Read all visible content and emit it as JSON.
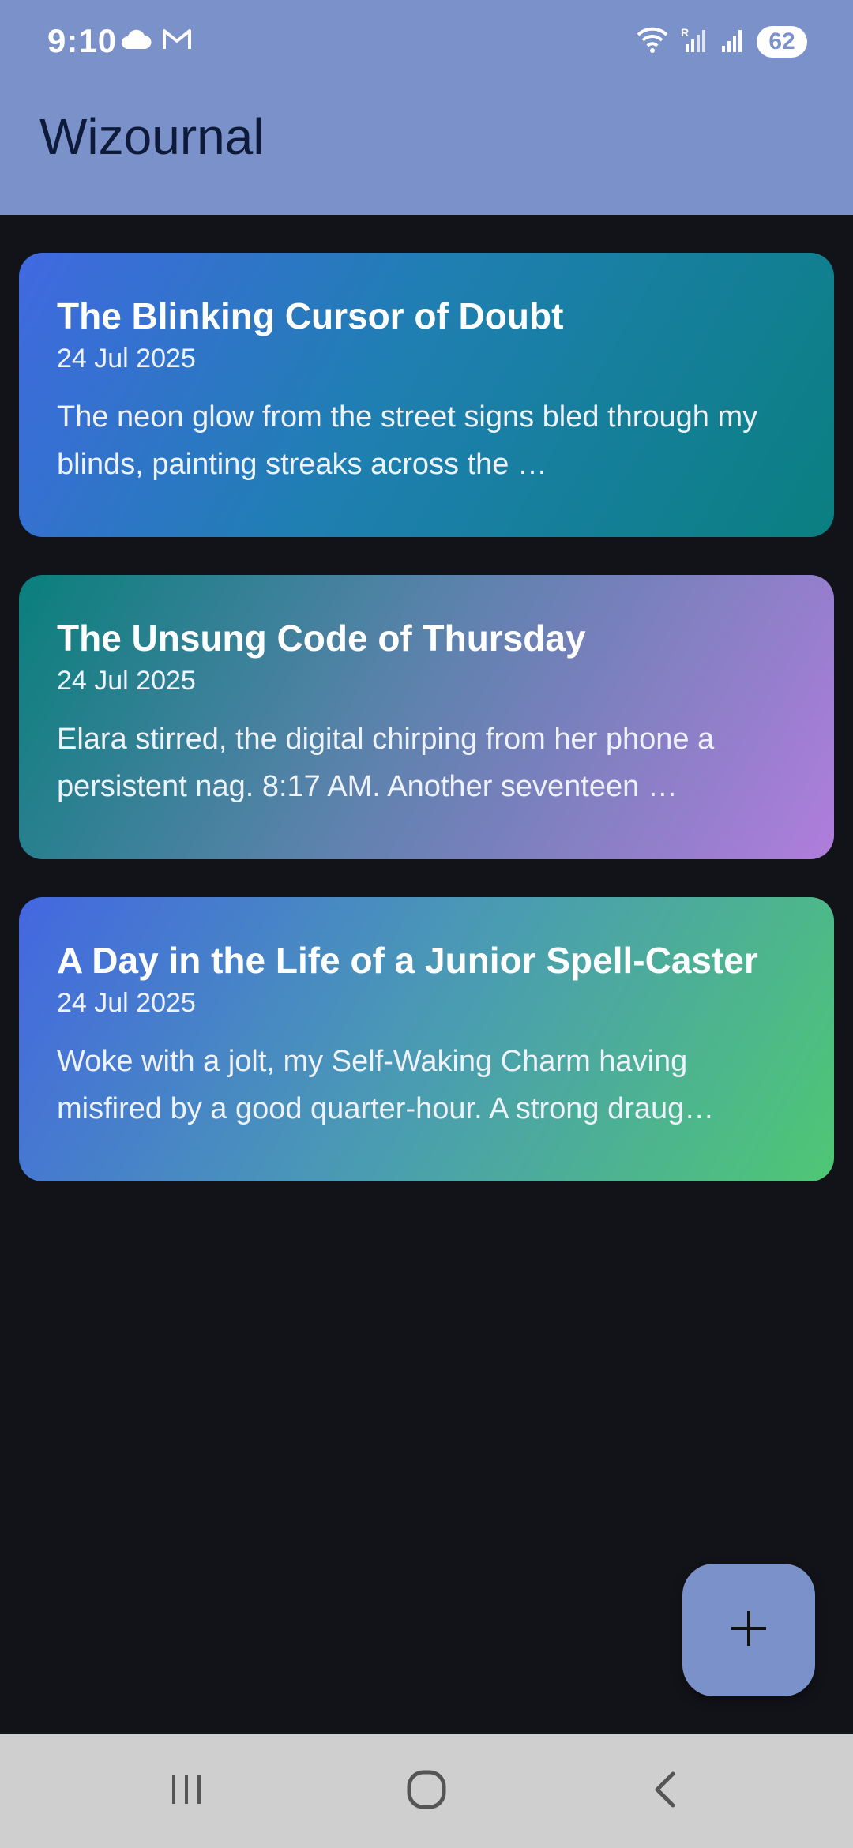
{
  "status_bar": {
    "time": "9:10",
    "battery": "62",
    "left_icons": [
      "cloud-icon",
      "gmail-icon"
    ],
    "right_icons": [
      "wifi-icon",
      "signal-r-icon",
      "signal-icon",
      "battery-icon"
    ]
  },
  "app_bar": {
    "title": "Wizournal",
    "color": "#7b91c9"
  },
  "entries": [
    {
      "title": "The Blinking Cursor of Doubt",
      "date": "24 Jul 2025",
      "excerpt": "The neon glow from the street signs bled through my blinds, painting streaks across the …"
    },
    {
      "title": "The Unsung Code of Thursday",
      "date": "24 Jul 2025",
      "excerpt": "Elara stirred, the digital chirping from her phone a persistent nag. 8:17 AM. Another seventeen …"
    },
    {
      "title": "A Day in the Life of a Junior Spell-Caster",
      "date": "24 Jul 2025",
      "excerpt": "Woke with a jolt, my Self-Waking Charm having misfired by a good quarter-hour. A strong draug…"
    }
  ],
  "fab": {
    "icon": "plus-icon"
  },
  "nav_bar": {
    "buttons": [
      "recents-icon",
      "home-icon",
      "back-icon"
    ]
  }
}
